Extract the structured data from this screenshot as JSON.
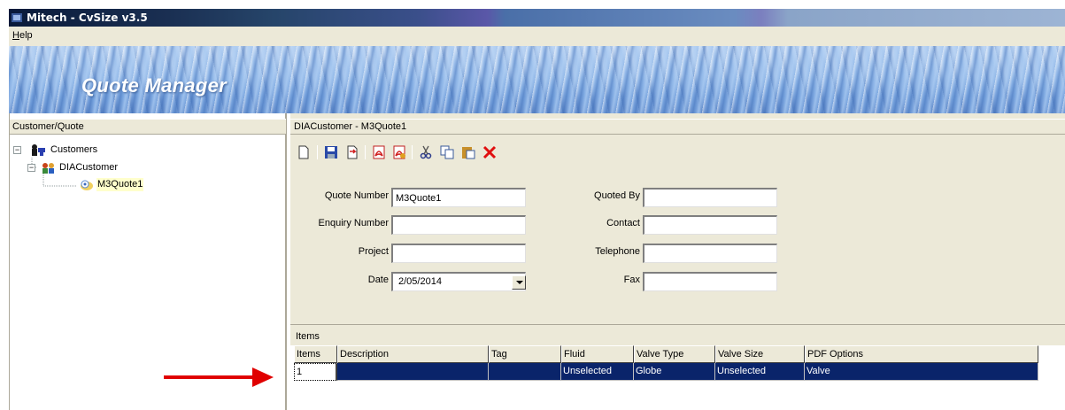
{
  "window": {
    "title": "Mitech - CvSize v3.5"
  },
  "menu": {
    "help_prefix": "H",
    "help_rest": "elp"
  },
  "banner": {
    "title": "Quote Manager"
  },
  "left_panel": {
    "header": "Customer/Quote",
    "tree": {
      "root": "Customers",
      "customer": "DIACustomer",
      "quote": "M3Quote1"
    }
  },
  "right_panel": {
    "header": "DIACustomer - M3Quote1",
    "toolbar": [
      "new-icon",
      "save-icon",
      "import-icon",
      "pdf-icon",
      "pdf-options-icon",
      "cut-icon",
      "copy-icon",
      "paste-icon",
      "delete-icon"
    ],
    "form": {
      "quote_number_label": "Quote Number",
      "quote_number_value": "M3Quote1",
      "enquiry_number_label": "Enquiry Number",
      "enquiry_number_value": "",
      "project_label": "Project",
      "project_value": "",
      "date_label": "Date",
      "date_value": "2/05/2014",
      "quoted_by_label": "Quoted By",
      "quoted_by_value": "",
      "contact_label": "Contact",
      "contact_value": "",
      "telephone_label": "Telephone",
      "telephone_value": "",
      "fax_label": "Fax",
      "fax_value": ""
    },
    "items": {
      "caption": "Items",
      "columns": [
        "Items",
        "Description",
        "Tag",
        "Fluid",
        "Valve Type",
        "Valve Size",
        "PDF Options"
      ],
      "rows": [
        [
          "1",
          "",
          "",
          "Unselected",
          "Globe",
          "Unselected",
          "Valve"
        ]
      ]
    }
  },
  "colors": {
    "selection": "#0a246a",
    "panel": "#ece9d8",
    "arrow": "#e00000"
  }
}
